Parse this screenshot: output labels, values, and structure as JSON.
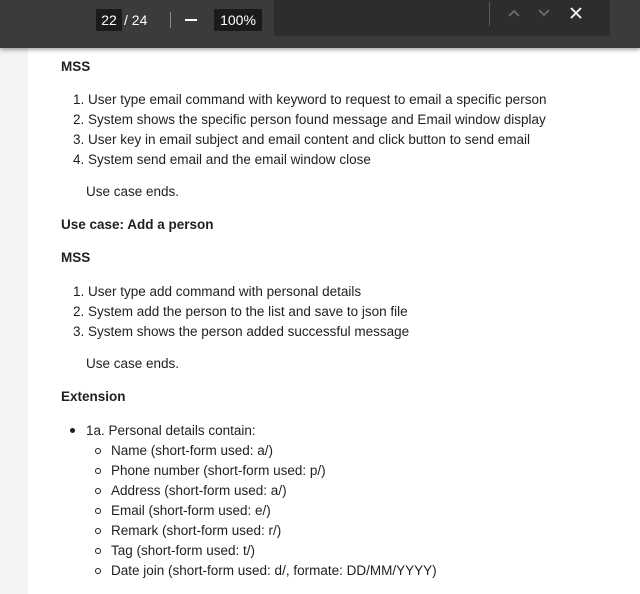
{
  "toolbar": {
    "current_page": "22",
    "total_pages": "/ 24",
    "zoom_level": "100%",
    "icons": [
      "zoom-out-icon",
      "chevron-up-icon",
      "chevron-down-icon",
      "close-icon"
    ]
  },
  "document": {
    "section1": {
      "heading": "MSS",
      "steps": [
        "1. User type email command with keyword to request to email a specific person",
        "2. System shows the specific person found message and Email window display",
        "3. User key in email subject and email content and click button to send email",
        "4. System send email and the email window close"
      ],
      "ends": "Use case ends."
    },
    "section2": {
      "title": "Use case: Add a person",
      "heading": "MSS",
      "steps": [
        "1. User type add command with personal details",
        "2. System add the person to the list and save to json file",
        "3. System shows the person added successful message"
      ],
      "ends": "Use case ends."
    },
    "extension": {
      "heading": "Extension",
      "item": "1a. Personal details contain:",
      "subitems": [
        "Name (short-form used: a/)",
        "Phone number (short-form used: p/)",
        "Address (short-form used: a/)",
        "Email (short-form used: e/)",
        "Remark (short-form used: r/)",
        "Tag (short-form used: t/)",
        "Date join (short-form used: d/, formate: DD/MM/YYYY)"
      ]
    }
  }
}
